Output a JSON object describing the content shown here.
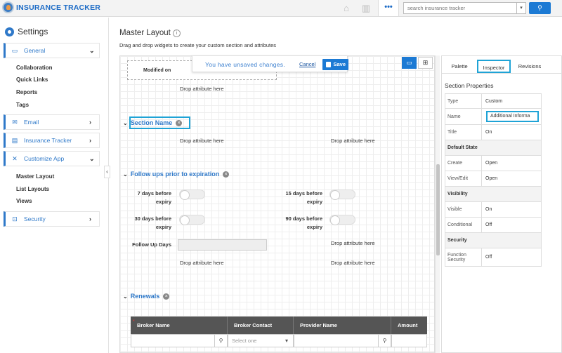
{
  "app": {
    "name": "INSURANCE TRACKER"
  },
  "topbar": {
    "home_icon": "home-icon",
    "chart_icon": "bar-chart-icon",
    "more_icon": "more-dots-icon",
    "more_label": "•••",
    "search_placeholder": "search insurance tracker",
    "search_icon": "search-icon"
  },
  "sidebar": {
    "title": "Settings",
    "general": {
      "label": "General"
    },
    "general_items": [
      "Collaboration",
      "Quick Links",
      "Reports",
      "Tags"
    ],
    "email": {
      "label": "Email"
    },
    "insurance": {
      "label": "Insurance Tracker"
    },
    "customize": {
      "label": "Customize App"
    },
    "customize_items": [
      "Master Layout",
      "List Layouts",
      "Views"
    ],
    "security": {
      "label": "Security"
    },
    "collapse_label": "‹"
  },
  "main": {
    "title": "Master Layout",
    "subtitle": "Drag and drop widgets to create your custom section and attributes"
  },
  "notice": {
    "message": "You have unsaved changes.",
    "cancel_label": "Cancel",
    "save_label": "Save"
  },
  "canvas": {
    "field_label": "Modified on",
    "drop_text": "Drop attribute here",
    "sections": [
      {
        "name": "Section Name"
      },
      {
        "name": "Follow ups prior to expiration"
      },
      {
        "name": "Renewals"
      }
    ],
    "followups": {
      "days7": "7 days before expiry",
      "days15": "15 days before expiry",
      "days30": "30 days before expiry",
      "days90": "90 days before expiry",
      "followup_days": "Follow Up Days"
    },
    "table": {
      "columns": [
        "Broker Name",
        "Broker Contact",
        "Provider Name",
        "Amount"
      ],
      "select_placeholder": "Select one"
    }
  },
  "panel": {
    "tabs": [
      "Palette",
      "Inspector",
      "Revisions"
    ],
    "section_title": "Section Properties",
    "rows": {
      "type": {
        "key": "Type",
        "value": "Custom"
      },
      "name": {
        "key": "Name",
        "value": "Additional Informa"
      },
      "title": {
        "key": "Title",
        "value": "On"
      },
      "default_state": "Default State",
      "create": {
        "key": "Create",
        "value": "Open"
      },
      "view_edit": {
        "key": "View/Edit",
        "value": "Open"
      },
      "visibility": "Visibility",
      "visible": {
        "key": "Visible",
        "value": "On"
      },
      "conditional": {
        "key": "Conditional",
        "value": "Off"
      },
      "security": "Security",
      "function_security": {
        "key": "Function Security",
        "value": "Off"
      }
    }
  }
}
